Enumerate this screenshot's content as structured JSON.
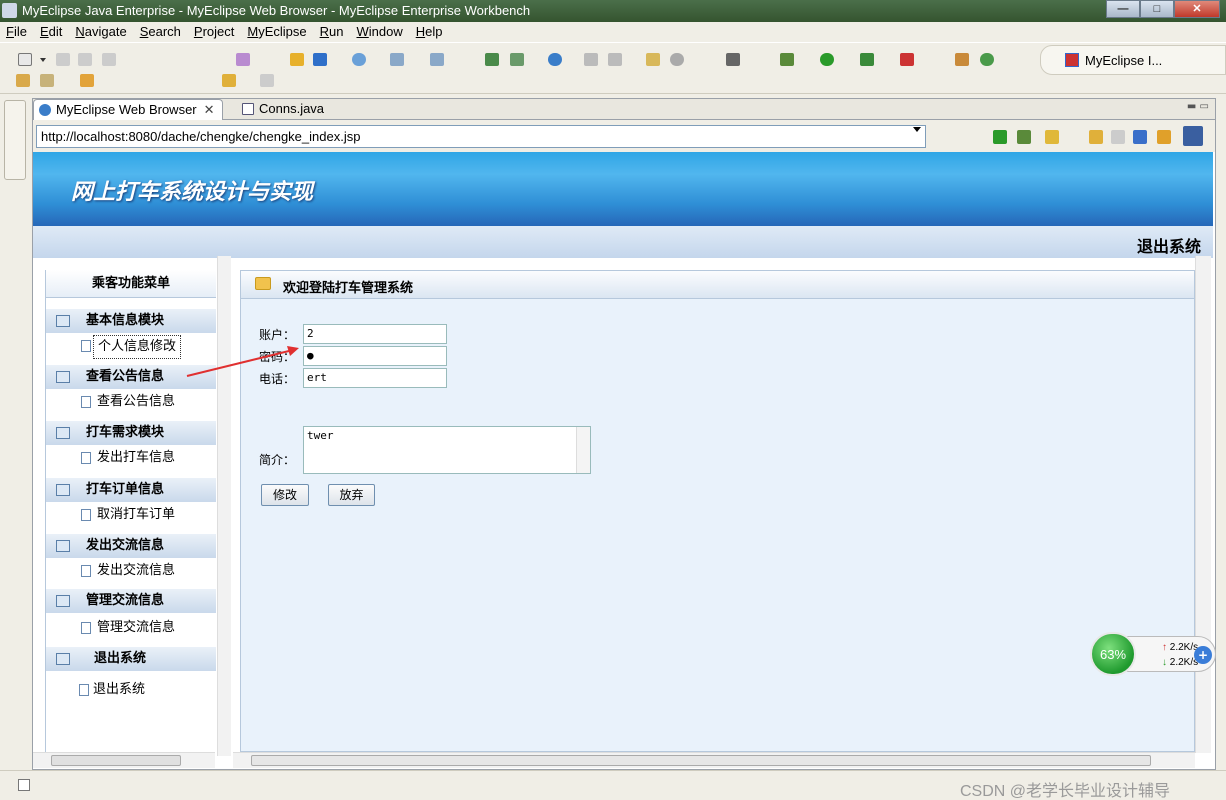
{
  "window": {
    "title": "MyEclipse Java Enterprise - MyEclipse Web Browser - MyEclipse Enterprise Workbench",
    "buttons": {
      "minimize": "—",
      "maximize": "□",
      "close": "✕"
    }
  },
  "menubar": [
    "File",
    "Edit",
    "Navigate",
    "Search",
    "Project",
    "MyEclipse",
    "Run",
    "Window",
    "Help"
  ],
  "perspective": {
    "label": "MyEclipse I..."
  },
  "editor": {
    "tabs": [
      {
        "label": "MyEclipse Web Browser",
        "close": "✕",
        "active": true
      },
      {
        "label": "Conns.java",
        "active": false
      }
    ],
    "url": "http://localhost:8080/dache/chengke/chengke_index.jsp"
  },
  "page": {
    "site_title": "网上打车系统设计与实现",
    "logout_top": "退出系统",
    "menu_header": "乘客功能菜单",
    "sections": [
      {
        "label": "基本信息模块",
        "item": "个人信息修改"
      },
      {
        "label": "查看公告信息",
        "item": "查看公告信息"
      },
      {
        "label": "打车需求模块",
        "item": "发出打车信息"
      },
      {
        "label": "打车订单信息",
        "item": "取消打车订单"
      },
      {
        "label": "发出交流信息",
        "item": "发出交流信息"
      },
      {
        "label": "管理交流信息",
        "item": "管理交流信息"
      },
      {
        "label": "退出系统",
        "item": "退出系统"
      }
    ],
    "content_title": "欢迎登陆打车管理系统",
    "form": {
      "account_label": "账户：",
      "account_value": "2",
      "password_label": "密码：",
      "password_value": "●",
      "phone_label": "电话：",
      "phone_value": "ert",
      "intro_label": "简介：",
      "intro_value": "twer",
      "submit_label": "修改",
      "cancel_label": "放弃"
    }
  },
  "network_widget": {
    "percent": "63%",
    "up": "2.2K/s",
    "down": "2.2K/s"
  },
  "watermark": "CSDN @老学长毕业设计辅导"
}
